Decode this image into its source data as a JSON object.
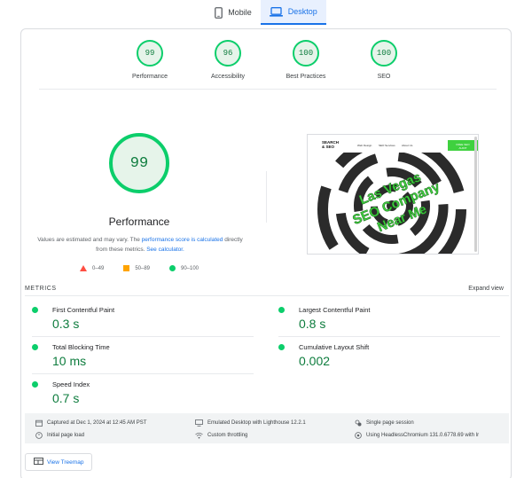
{
  "tabs": [
    {
      "label": "Mobile",
      "icon": "phone-icon",
      "active": false
    },
    {
      "label": "Desktop",
      "icon": "laptop-icon",
      "active": true
    }
  ],
  "summary": [
    {
      "score": "99",
      "label": "Performance"
    },
    {
      "score": "96",
      "label": "Accessibility"
    },
    {
      "score": "100",
      "label": "Best Practices"
    },
    {
      "score": "100",
      "label": "SEO"
    }
  ],
  "performance": {
    "score": "99",
    "title": "Performance",
    "note_prefix": "Values are estimated and may vary. The ",
    "note_link1": "performance score is calculated",
    "note_mid": " directly from these metrics. ",
    "note_link2": "See calculator."
  },
  "legend": [
    {
      "shape": "triangle",
      "color": "#ff4e42",
      "label": "0–49"
    },
    {
      "shape": "square",
      "color": "#ffa400",
      "label": "50–89"
    },
    {
      "shape": "circle",
      "color": "#0cce6b",
      "label": "90–100"
    }
  ],
  "thumbnail": {
    "logo_line1": "SEARCH",
    "logo_line2": "& SEO",
    "nav_links": [
      "Web Design",
      "SEO Services",
      "About Us"
    ],
    "cta_line1": "FREE SEO",
    "cta_line2": "AUDIT",
    "headline": [
      "Las Vegas",
      "SEO Company",
      "Near Me"
    ]
  },
  "metrics_header": {
    "label": "METRICS",
    "expand": "Expand view"
  },
  "metrics": [
    {
      "name": "First Contentful Paint",
      "value": "0.3 s"
    },
    {
      "name": "Largest Contentful Paint",
      "value": "0.8 s"
    },
    {
      "name": "Total Blocking Time",
      "value": "10 ms"
    },
    {
      "name": "Cumulative Layout Shift",
      "value": "0.002"
    },
    {
      "name": "Speed Index",
      "value": "0.7 s"
    }
  ],
  "info": [
    {
      "icon": "calendar-icon",
      "text": "Captured at Dec 1, 2024 at 12:45 AM PST"
    },
    {
      "icon": "desktop-icon",
      "text": "Emulated Desktop with Lighthouse 12.2.1"
    },
    {
      "icon": "session-icon",
      "text": "Single page session"
    },
    {
      "icon": "timer-icon",
      "text": "Initial page load"
    },
    {
      "icon": "wifi-icon",
      "text": "Custom throttling"
    },
    {
      "icon": "chromium-icon",
      "text": "Using HeadlessChromium 131.0.6778.69 with lr"
    }
  ],
  "treemap": {
    "label": "View Treemap"
  },
  "colors": {
    "pass": "#0cce6b",
    "pass_text": "#0d7c3d",
    "accent": "#1a73e8",
    "average": "#ffa400",
    "fail": "#ff4e42"
  }
}
